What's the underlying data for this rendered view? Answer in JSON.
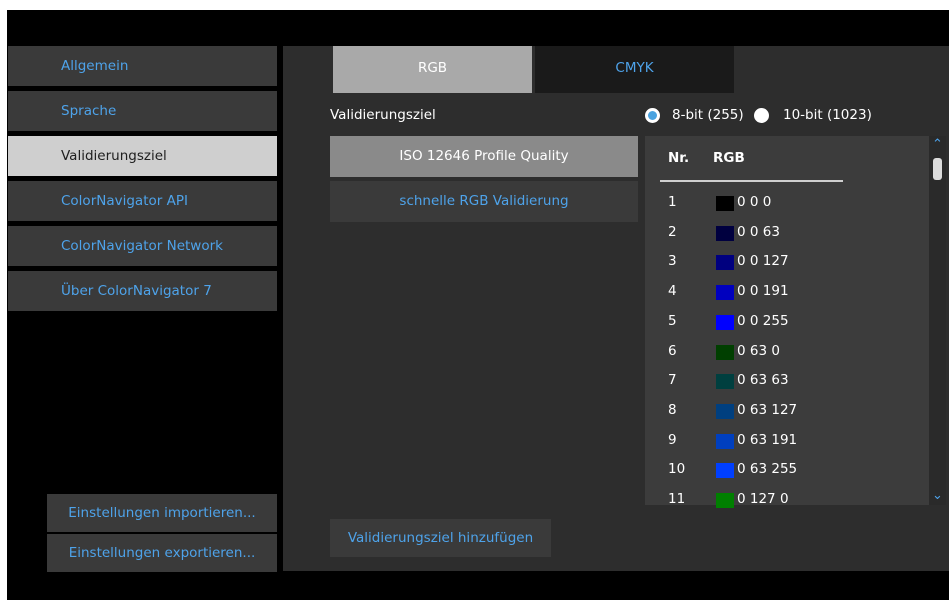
{
  "sidebar": {
    "items": [
      {
        "label": "Allgemein"
      },
      {
        "label": "Sprache"
      },
      {
        "label": "Validierungsziel"
      },
      {
        "label": "ColorNavigator API"
      },
      {
        "label": "ColorNavigator Network"
      },
      {
        "label": "Über ColorNavigator 7"
      }
    ],
    "import_label": "Einstellungen importieren...",
    "export_label": "Einstellungen exportieren..."
  },
  "tabs": [
    {
      "label": "RGB"
    },
    {
      "label": "CMYK"
    }
  ],
  "section_label": "Validierungsziel",
  "bit_options": [
    {
      "label": "8-bit (255)",
      "checked": true
    },
    {
      "label": "10-bit (1023)",
      "checked": false
    }
  ],
  "targets": [
    {
      "label": "ISO 12646 Profile Quality"
    },
    {
      "label": "schnelle RGB Validierung"
    }
  ],
  "table": {
    "headers": [
      "Nr.",
      "RGB"
    ],
    "rows": [
      {
        "nr": "1",
        "rgb": "0 0 0",
        "color": "#000000"
      },
      {
        "nr": "2",
        "rgb": "0 0 63",
        "color": "#00003f"
      },
      {
        "nr": "3",
        "rgb": "0 0 127",
        "color": "#00007f"
      },
      {
        "nr": "4",
        "rgb": "0 0 191",
        "color": "#0000bf"
      },
      {
        "nr": "5",
        "rgb": "0 0 255",
        "color": "#0000ff"
      },
      {
        "nr": "6",
        "rgb": "0 63 0",
        "color": "#003f00"
      },
      {
        "nr": "7",
        "rgb": "0 63 63",
        "color": "#003f3f"
      },
      {
        "nr": "8",
        "rgb": "0 63 127",
        "color": "#003f7f"
      },
      {
        "nr": "9",
        "rgb": "0 63 191",
        "color": "#003fbf"
      },
      {
        "nr": "10",
        "rgb": "0 63 255",
        "color": "#003fff"
      },
      {
        "nr": "11",
        "rgb": "0 127 0",
        "color": "#007f00"
      }
    ]
  },
  "add_button_label": "Validierungsziel hinzufügen"
}
